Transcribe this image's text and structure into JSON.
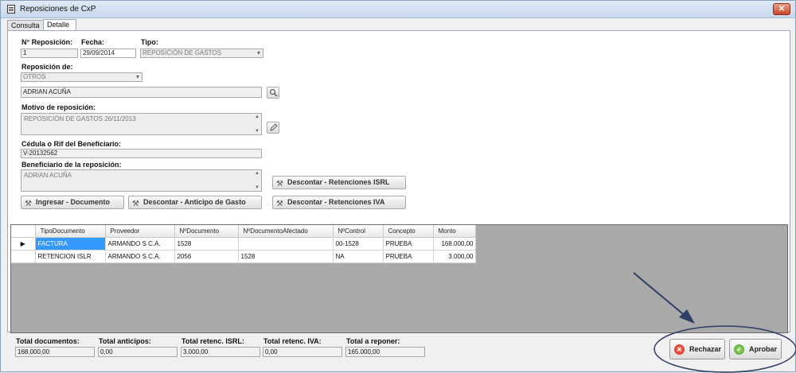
{
  "window": {
    "title": "Reposiciones de CxP",
    "close_glyph": "✕"
  },
  "tabs": [
    {
      "label": "Consulta"
    },
    {
      "label": "Detalle"
    }
  ],
  "form": {
    "nro_label": "N° Reposición:",
    "nro_value": "1",
    "fecha_label": "Fecha:",
    "fecha_value": "29/09/2014",
    "tipo_label": "Tipo:",
    "tipo_value": "REPOSICIÓN DE GASTOS",
    "reposicion_de_label": "Reposición de:",
    "reposicion_de_value": "OTROS",
    "beneficiario_value": "ADRIAN ACUÑA",
    "motivo_label": "Motivo de reposición:",
    "motivo_value": "REPOSICIÓN DE GASTOS 26/11/2013",
    "cedula_label": "Cédula o Rif del Beneficiario:",
    "cedula_value": "V-20132562",
    "beneficiario_rep_label": "Beneficiario de la reposición:",
    "beneficiario_rep_value": "ADRIAN ACUÑA"
  },
  "buttons": {
    "ingresar_documento": "Ingresar - Documento",
    "descontar_anticipo": "Descontar - Anticipo de Gasto",
    "descontar_islr": "Descontar - Retenciones ISRL",
    "descontar_iva": "Descontar - Retenciones IVA",
    "rechazar": "Rechazar",
    "aprobar": "Aprobar"
  },
  "grid": {
    "columns": [
      "TipoDocumento",
      "Proveedor",
      "NºDocumento",
      "NºDocumentoAfectado",
      "NºControl",
      "Concepto",
      "Monto"
    ],
    "current_row_marker": "▶",
    "rows": [
      {
        "tipo": "FACTURA",
        "proveedor": "ARMANDO S C.A.",
        "documento": "1528",
        "afectado": "",
        "control": "00-1528",
        "concepto": "PRUEBA",
        "monto": "168.000,00"
      },
      {
        "tipo": "RETENCION ISLR",
        "proveedor": "ARMANDO S C.A.",
        "documento": "2056",
        "afectado": "1528",
        "control": "NA",
        "concepto": "PRUEBA",
        "monto": "3.000,00"
      }
    ]
  },
  "totals": {
    "documentos_label": "Total documentos:",
    "documentos_value": "168.000,00",
    "anticipos_label": "Total anticipos:",
    "anticipos_value": "0,00",
    "islr_label": "Total retenc. ISRL:",
    "islr_value": "3.000,00",
    "iva_label": "Total retenc. IVA:",
    "iva_value": "0,00",
    "reponer_label": "Total a reponer:",
    "reponer_value": "165.000,00"
  },
  "icons": {
    "search": "search-icon",
    "edit": "edit-icon",
    "tool": "wrench-icon",
    "reject": "reject-icon",
    "approve": "approve-icon"
  },
  "colors": {
    "selection": "#3399ff",
    "annotation": "#2e3f66",
    "reject": "#c8261a",
    "approve": "#3f9a23"
  }
}
